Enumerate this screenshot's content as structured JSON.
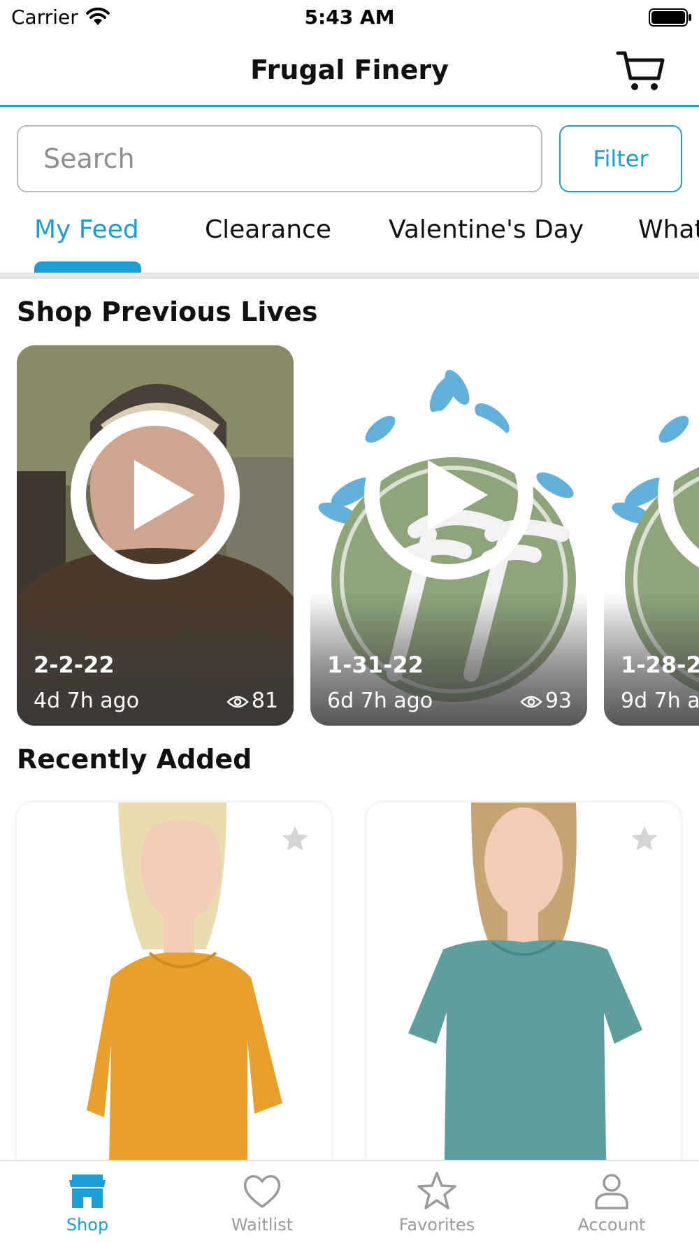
{
  "status_bar": {
    "carrier": "Carrier",
    "time": "5:43 AM"
  },
  "nav": {
    "title": "Frugal Finery"
  },
  "search": {
    "placeholder": "Search",
    "filter_label": "Filter"
  },
  "tabs": [
    {
      "label": "My Feed",
      "active": true
    },
    {
      "label": "Clearance"
    },
    {
      "label": "Valentine's Day"
    },
    {
      "label": "What"
    }
  ],
  "sections": {
    "lives_title": "Shop Previous Lives",
    "recent_title": "Recently Added"
  },
  "lives": [
    {
      "date": "2-2-22",
      "ago": "4d 7h ago",
      "views": "81"
    },
    {
      "date": "1-31-22",
      "ago": "6d 7h ago",
      "views": "93"
    },
    {
      "date": "1-28-22",
      "ago": "9d 7h a"
    }
  ],
  "products": [
    {
      "color": "#e8a02a",
      "favorite_icon": "star-icon"
    },
    {
      "color": "#5e9e9c",
      "favorite_icon": "star-icon"
    }
  ],
  "tab_bar": [
    {
      "label": "Shop",
      "icon": "storefront-icon",
      "active": true
    },
    {
      "label": "Waitlist",
      "icon": "heart-icon"
    },
    {
      "label": "Favorites",
      "icon": "star-icon"
    },
    {
      "label": "Account",
      "icon": "person-icon"
    }
  ],
  "colors": {
    "accent": "#1a9fd6",
    "inactive": "#9a9a9a"
  }
}
